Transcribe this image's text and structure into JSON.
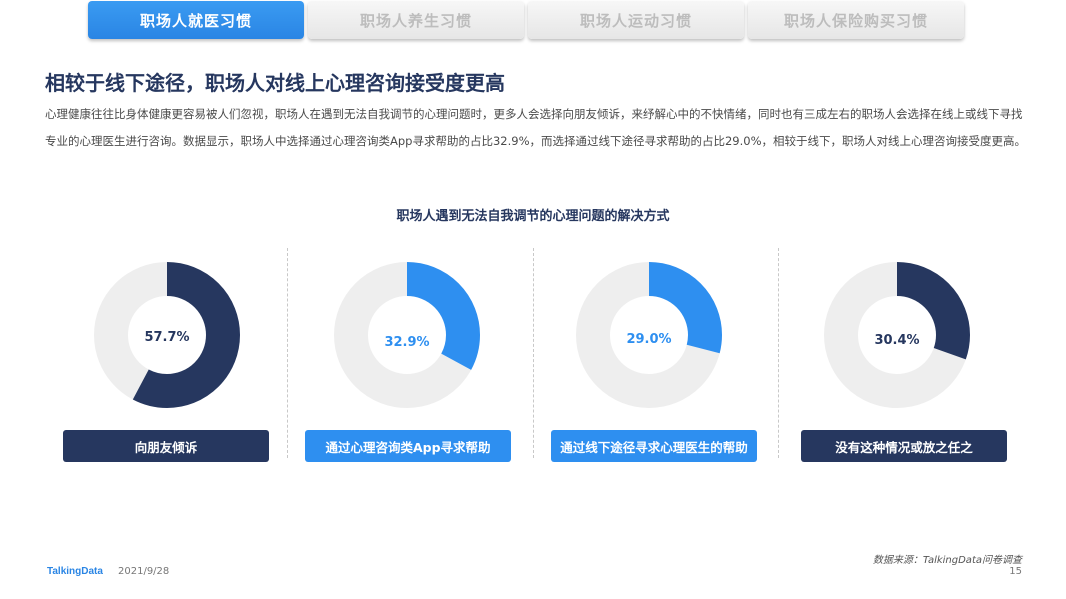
{
  "tabs": [
    {
      "label": "职场人就医习惯",
      "active": true
    },
    {
      "label": "职场人养生习惯",
      "active": false
    },
    {
      "label": "职场人运动习惯",
      "active": false
    },
    {
      "label": "职场人保险购买习惯",
      "active": false
    }
  ],
  "headline": "相较于线下途径，职场人对线上心理咨询接受度更高",
  "paragraph": "心理健康往往比身体健康更容易被人们忽视，职场人在遇到无法自我调节的心理问题时，更多人会选择向朋友倾诉，来纾解心中的不快情绪，同时也有三成左右的职场人会选择在线上或线下寻找专业的心理医生进行咨询。数据显示，职场人中选择通过心理咨询类App寻求帮助的占比32.9%，而选择通过线下途径寻求帮助的占比29.0%，相较于线下，职场人对线上心理咨询接受度更高。",
  "chart_data": {
    "type": "pie",
    "title": "职场人遇到无法自我调节的心理问题的解决方式",
    "categories": [
      "向朋友倾诉",
      "通过心理咨询类App寻求帮助",
      "通过线下途径寻求心理医生的帮助",
      "没有这种情况或放之任之"
    ],
    "values": [
      57.7,
      32.9,
      29.0,
      30.4
    ],
    "labels": [
      "57.7%",
      "32.9%",
      "29.0%",
      "30.4%"
    ],
    "unit": "%",
    "colors": [
      "#26375f",
      "#2e8ff0",
      "#2e8ff0",
      "#26375f"
    ],
    "track_color": "#eeeeee",
    "label_colors": [
      "#26375f",
      "#2e8ff0",
      "#2e8ff0",
      "#26375f"
    ]
  },
  "footer": {
    "source": "数据来源：TalkingData问卷调查",
    "logo": "TalkingData",
    "date": "2021/9/28",
    "page": "15"
  }
}
